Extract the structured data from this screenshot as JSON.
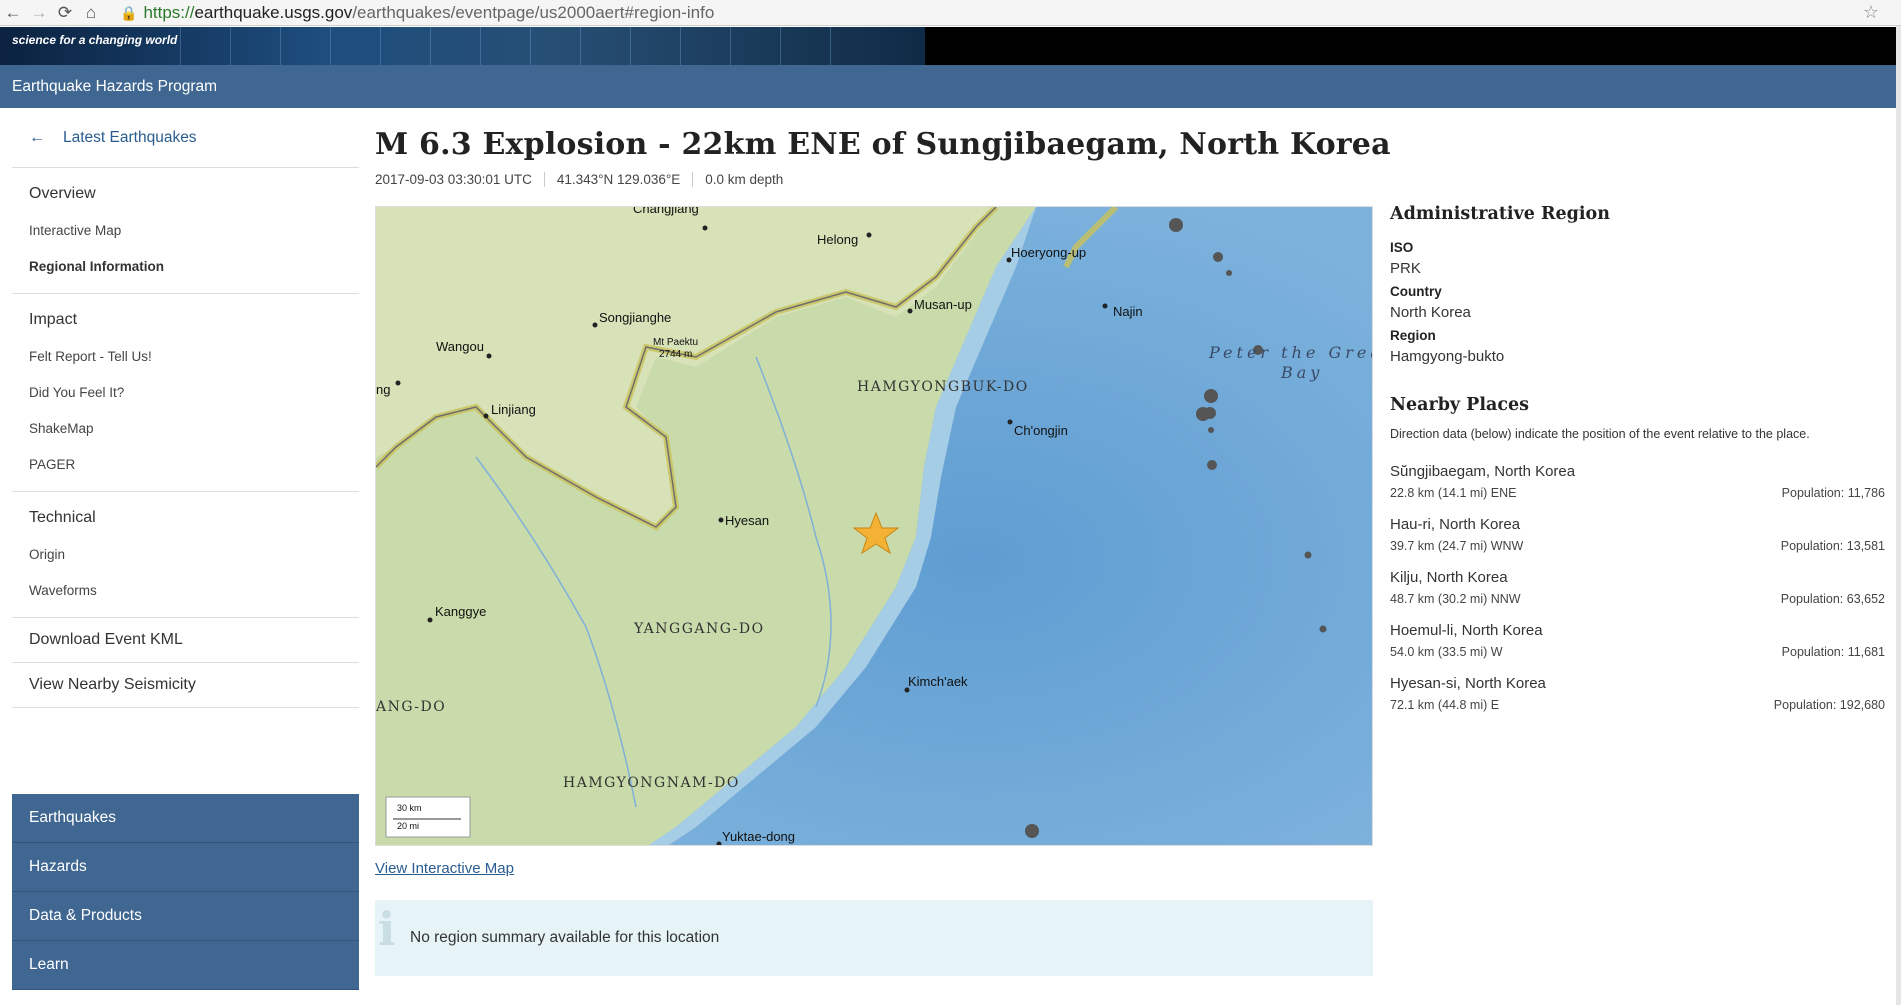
{
  "browser": {
    "url_scheme": "https://",
    "url_host": "earthquake.usgs.gov",
    "url_rest": "/earthquakes/eventpage/us2000aert#region-info"
  },
  "banner": {
    "tagline": "science for a changing world"
  },
  "program": {
    "title": "Earthquake Hazards Program"
  },
  "sidebar": {
    "back_label": "Latest Earthquakes",
    "groups": [
      {
        "head": "Overview",
        "items": [
          "Interactive Map",
          "Regional Information"
        ]
      },
      {
        "head": "Impact",
        "items": [
          "Felt Report - Tell Us!",
          "Did You Feel It?",
          "ShakeMap",
          "PAGER"
        ]
      },
      {
        "head": "Technical",
        "items": [
          "Origin",
          "Waveforms"
        ]
      }
    ],
    "singles": [
      "Download Event KML",
      "View Nearby Seismicity"
    ],
    "blue_nav": [
      "Earthquakes",
      "Hazards",
      "Data & Products",
      "Learn"
    ]
  },
  "event": {
    "title": "M 6.3 Explosion - 22km ENE of Sungjibaegam, North Korea",
    "time": "2017-09-03 03:30:01 UTC",
    "location": "41.343°N  129.036°E",
    "depth": "0.0 km depth"
  },
  "map": {
    "labels": {
      "zhangjiang": "Changjiang",
      "helong": "Helong",
      "hoeryong": "Hoeryong-up",
      "songjianghe": "Songjianghe",
      "musan": "Musan-up",
      "najin": "Najin",
      "wangou": "Wangou",
      "paektu": "Mt Paektu",
      "paektu_elev": "2744 m",
      "sea1": "Peter the Grea",
      "sea2": "Bay",
      "hamgyongbuk": "HAMGYONGBUK-DO",
      "ng": "ng",
      "linjiang": "Linjiang",
      "chongjin": "Ch'ongjin",
      "hyesan": "Hyesan",
      "kanggye": "Kanggye",
      "yanggang": "YANGGANG-DO",
      "kimchaek": "Kimch'aek",
      "ang_do": "ANG-DO",
      "hamgyongnam": "HAMGYONGNAM-DO",
      "yuktae": "Yuktae-dong",
      "scale_km": "30 km",
      "scale_mi": "20 mi"
    },
    "colors": {
      "land": "#c9d9a8",
      "sea": "#7eb4dc",
      "deep": "#5e9dd1",
      "border": "#c9c25a"
    },
    "link_label": "View Interactive Map"
  },
  "summary": {
    "text": "No region summary available for this location"
  },
  "admin": {
    "heading": "Administrative Region",
    "fields": [
      {
        "label": "ISO",
        "value": "PRK"
      },
      {
        "label": "Country",
        "value": "North Korea"
      },
      {
        "label": "Region",
        "value": "Hamgyong-bukto"
      }
    ]
  },
  "nearby": {
    "heading": "Nearby Places",
    "description": "Direction data (below) indicate the position of the event relative to the place.",
    "places": [
      {
        "name": "Sŭngjibaegam, North Korea",
        "distance": "22.8 km (14.1 mi) ENE",
        "population": "Population: 11,786"
      },
      {
        "name": "Hau-ri, North Korea",
        "distance": "39.7 km (24.7 mi) WNW",
        "population": "Population: 13,581"
      },
      {
        "name": "Kilju, North Korea",
        "distance": "48.7 km (30.2 mi) NNW",
        "population": "Population: 63,652"
      },
      {
        "name": "Hoemul-li, North Korea",
        "distance": "54.0 km (33.5 mi) W",
        "population": "Population: 11,681"
      },
      {
        "name": "Hyesan-si, North Korea",
        "distance": "72.1 km (44.8 mi) E",
        "population": "Population: 192,680"
      }
    ]
  }
}
